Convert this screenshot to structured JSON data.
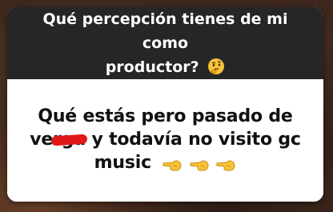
{
  "story": {
    "question": {
      "line1": "Qué percepción tienes de mi como",
      "line2": "productor?",
      "emoji_icon": "thinking-face-icon"
    },
    "answer": {
      "part1": "Qué estás pero pasado de",
      "redacted_fragment": "rga",
      "part2_prefix": "ve",
      "part2": "y todavía no visito gc",
      "part3": "music",
      "emoji_icons": [
        "backhand-index-pointing-left-icon",
        "backhand-index-pointing-left-icon",
        "backhand-index-pointing-left-icon"
      ]
    }
  },
  "colors": {
    "question_bg": "#262626",
    "answer_bg": "#ffffff",
    "redaction": "#e01818"
  }
}
